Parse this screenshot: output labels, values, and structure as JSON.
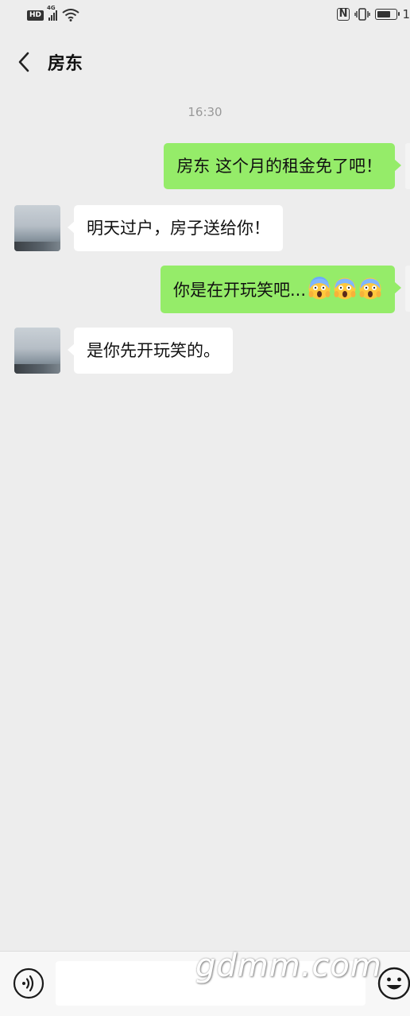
{
  "status_bar": {
    "hd_label": "HD",
    "network_label": "4G",
    "battery_level": 0.58,
    "battery_text": "1"
  },
  "header": {
    "title": "房东",
    "back_icon": "chevron-left-icon"
  },
  "chat": {
    "timestamp": "16:30",
    "messages": [
      {
        "side": "out",
        "text": "房东 这个月的租金免了吧！"
      },
      {
        "side": "in",
        "text": "明天过户，房子送给你！"
      },
      {
        "side": "out",
        "text": "你是在开玩笑吧...",
        "emoji": [
          "screaming-face-icon",
          "screaming-face-icon",
          "screaming-face-icon"
        ]
      },
      {
        "side": "in",
        "text": "是你先开玩笑的。"
      }
    ]
  },
  "input_bar": {
    "voice_icon": "voice-icon",
    "text_value": "",
    "emoji_icon": "smiley-icon"
  },
  "watermark": "gdmm.com",
  "colors": {
    "background": "#EDEDED",
    "outgoing_bubble": "#95EC69",
    "incoming_bubble": "#FFFFFF",
    "timestamp": "#999999"
  }
}
